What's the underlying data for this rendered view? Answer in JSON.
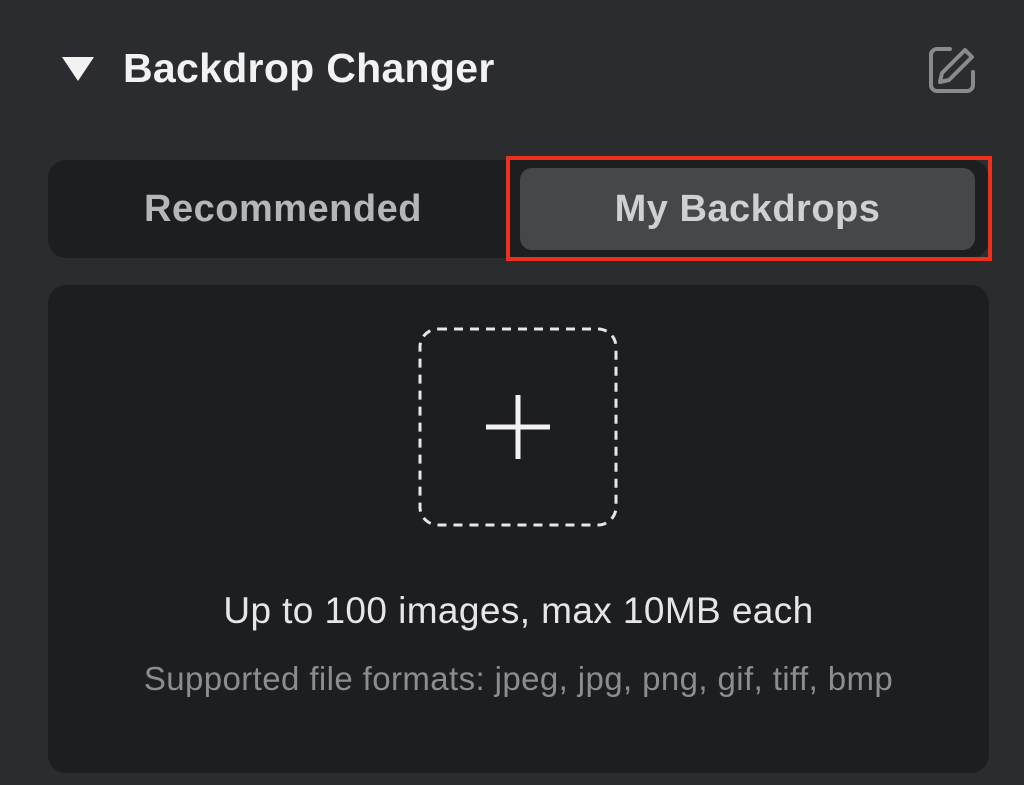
{
  "panel": {
    "title": "Backdrop Changer",
    "collapse_icon": "caret-down-icon",
    "edit_icon": "edit-icon"
  },
  "tabs": {
    "items": [
      {
        "label": "Recommended",
        "active": false
      },
      {
        "label": "My Backdrops",
        "active": true
      }
    ],
    "highlight_color": "#ee2f1c"
  },
  "upload": {
    "icon": "plus-icon",
    "limit_text": "Up to 100 images, max 10MB each",
    "formats_text": "Supported file formats: jpeg, jpg, png, gif, tiff, bmp"
  },
  "colors": {
    "background": "#2b2c30",
    "card": "#1d1e21",
    "active_tab": "#46474b"
  }
}
